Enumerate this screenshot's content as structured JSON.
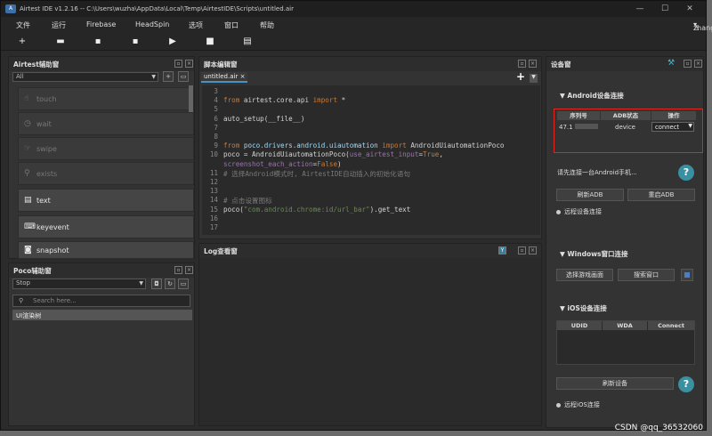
{
  "app": {
    "title": "Airtest IDE v1.2.16 -- C:\\Users\\wuzha\\AppData\\Local\\Temp\\AirtestIDE\\Scripts\\untitled.air",
    "user": "zhangyinwu"
  },
  "menu": [
    "文件",
    "运行",
    "Firebase",
    "HeadSpin",
    "选项",
    "窗口",
    "帮助"
  ],
  "airtest": {
    "title": "Airtest辅助窗",
    "filter": "All",
    "buttons": [
      "touch",
      "wait",
      "swipe",
      "exists",
      "text",
      "keyevent",
      "snapshot"
    ]
  },
  "poco": {
    "title": "Poco辅助窗",
    "mode": "Stop",
    "search_placeholder": "Search here...",
    "tree_item": "UI渲染树"
  },
  "editor": {
    "title": "脚本编辑窗",
    "tab": "untitled.air",
    "close": "×",
    "lines": [
      {
        "n": "3",
        "t": ""
      },
      {
        "n": "4",
        "t": "from airtest.core.api import *"
      },
      {
        "n": "5",
        "t": ""
      },
      {
        "n": "6",
        "t": "auto_setup(__file__)"
      },
      {
        "n": "7",
        "t": ""
      },
      {
        "n": "8",
        "t": ""
      },
      {
        "n": "9",
        "t": "from poco.drivers.android.uiautomation import AndroidUiautomationPoco"
      },
      {
        "n": "10",
        "t": "poco = AndroidUiautomationPoco(use_airtest_input=True,"
      },
      {
        "n": "",
        "t": "screenshot_each_action=False)"
      },
      {
        "n": "11",
        "t": "# 选择Android模式时, AirtestIDE自动插入的初始化语句"
      },
      {
        "n": "12",
        "t": ""
      },
      {
        "n": "13",
        "t": ""
      },
      {
        "n": "14",
        "t": "# 点击设置图标"
      },
      {
        "n": "15",
        "t": "poco(\"com.android.chrome:id/url_bar\").get_text"
      },
      {
        "n": "16",
        "t": ""
      },
      {
        "n": "17",
        "t": ""
      }
    ]
  },
  "log": {
    "title": "Log查看窗"
  },
  "device": {
    "title": "设备窗",
    "android_section": "Android设备连接",
    "columns": [
      "序列号",
      "ADB状态",
      "操作"
    ],
    "row": {
      "serial": "47.1",
      "status": "device",
      "action": "connect"
    },
    "hint": "请先连接一台Android手机...",
    "refresh_adb": "刷新ADB",
    "restart_adb": "重启ADB",
    "remote": "远程设备连接",
    "windows_section": "Windows窗口连接",
    "select_game": "选择游戏画面",
    "search_window": "搜索窗口",
    "ios_section": "iOS设备连接",
    "ios_columns": [
      "UDID",
      "WDA",
      "Connect"
    ],
    "refresh_device": "刷新设备",
    "remote_ios": "远程iOS连接",
    "help": "?"
  },
  "watermark": "CSDN @qq_36532060"
}
